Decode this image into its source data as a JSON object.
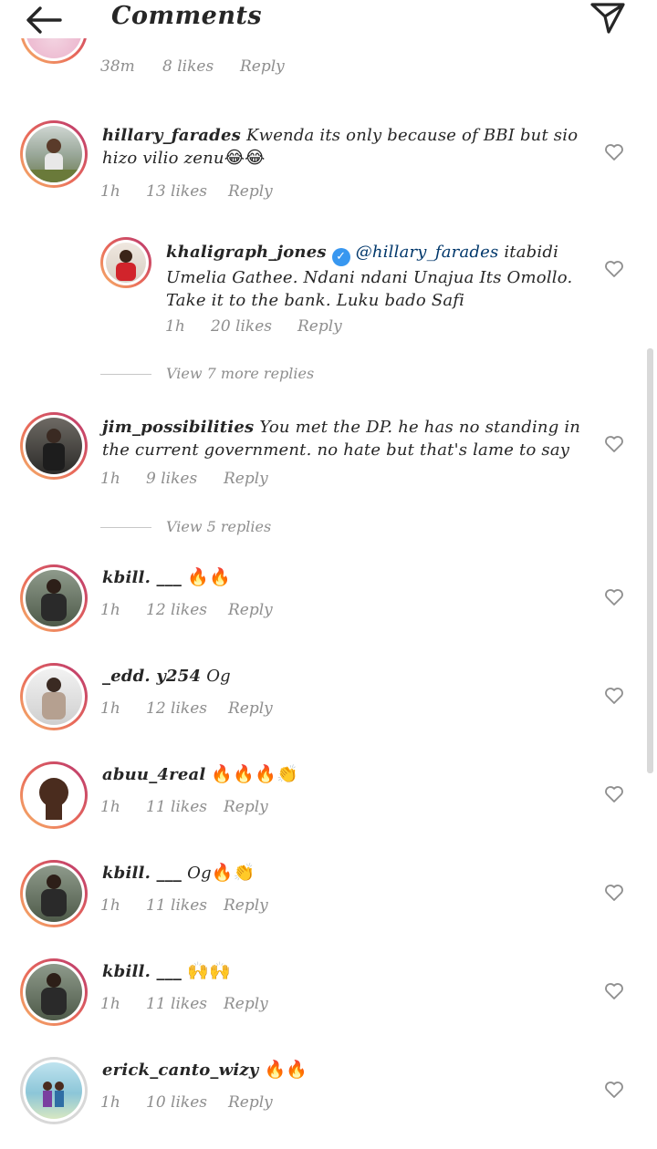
{
  "header": {
    "title": "Comments",
    "back_icon": "arrow-left-icon",
    "share_icon": "paper-plane-icon"
  },
  "partial_comment": {
    "time": "38m",
    "likes": "8 likes",
    "reply": "Reply"
  },
  "comments": [
    {
      "username": "hillary_farades",
      "text": "Kwenda its only because of BBI but sio hizo vilio zenu",
      "emoji": "😂😂",
      "time": "1h",
      "likes": "13 likes",
      "reply": "Reply"
    },
    {
      "username": "khaligraph_jones",
      "verified": true,
      "mention": "@hillary_farades",
      "text": "itabidi Umelia Gathee. Ndani ndani Unajua Its Omollo. Take it to the bank. Luku bado Safi",
      "time": "1h",
      "likes": "20 likes",
      "reply": "Reply"
    },
    {
      "username": "jim_possibilities",
      "text": "You met the DP. he has no standing in the current government. no hate but that's lame to say",
      "time": "1h",
      "likes": "9 likes",
      "reply": "Reply"
    },
    {
      "username": "kbill. ___",
      "text": "",
      "emoji": "🔥🔥",
      "time": "1h",
      "likes": "12 likes",
      "reply": "Reply"
    },
    {
      "username": "_edd. y254",
      "text": "Og",
      "time": "1h",
      "likes": "12 likes",
      "reply": "Reply"
    },
    {
      "username": "abuu_4real",
      "text": "",
      "emoji": "🔥🔥🔥👏",
      "time": "1h",
      "likes": "11 likes",
      "reply": "Reply"
    },
    {
      "username": "kbill. ___",
      "text": "Og",
      "emoji": "🔥👏",
      "time": "1h",
      "likes": "11 likes",
      "reply": "Reply"
    },
    {
      "username": "kbill. ___",
      "text": "",
      "emoji": "🙌🙌",
      "time": "1h",
      "likes": "11 likes",
      "reply": "Reply"
    },
    {
      "username": "erick_canto_wizy",
      "text": "",
      "emoji": "🔥🔥",
      "time": "1h",
      "likes": "10 likes",
      "reply": "Reply"
    }
  ],
  "view_replies": [
    {
      "label": "View 7 more replies"
    },
    {
      "label": "View 5 replies"
    }
  ],
  "colors": {
    "text": "#262626",
    "meta": "#8e8e8e",
    "mention": "#00376b",
    "verified": "#3897f0",
    "ring_start": "#f6b56a",
    "ring_end": "#b8356f"
  }
}
